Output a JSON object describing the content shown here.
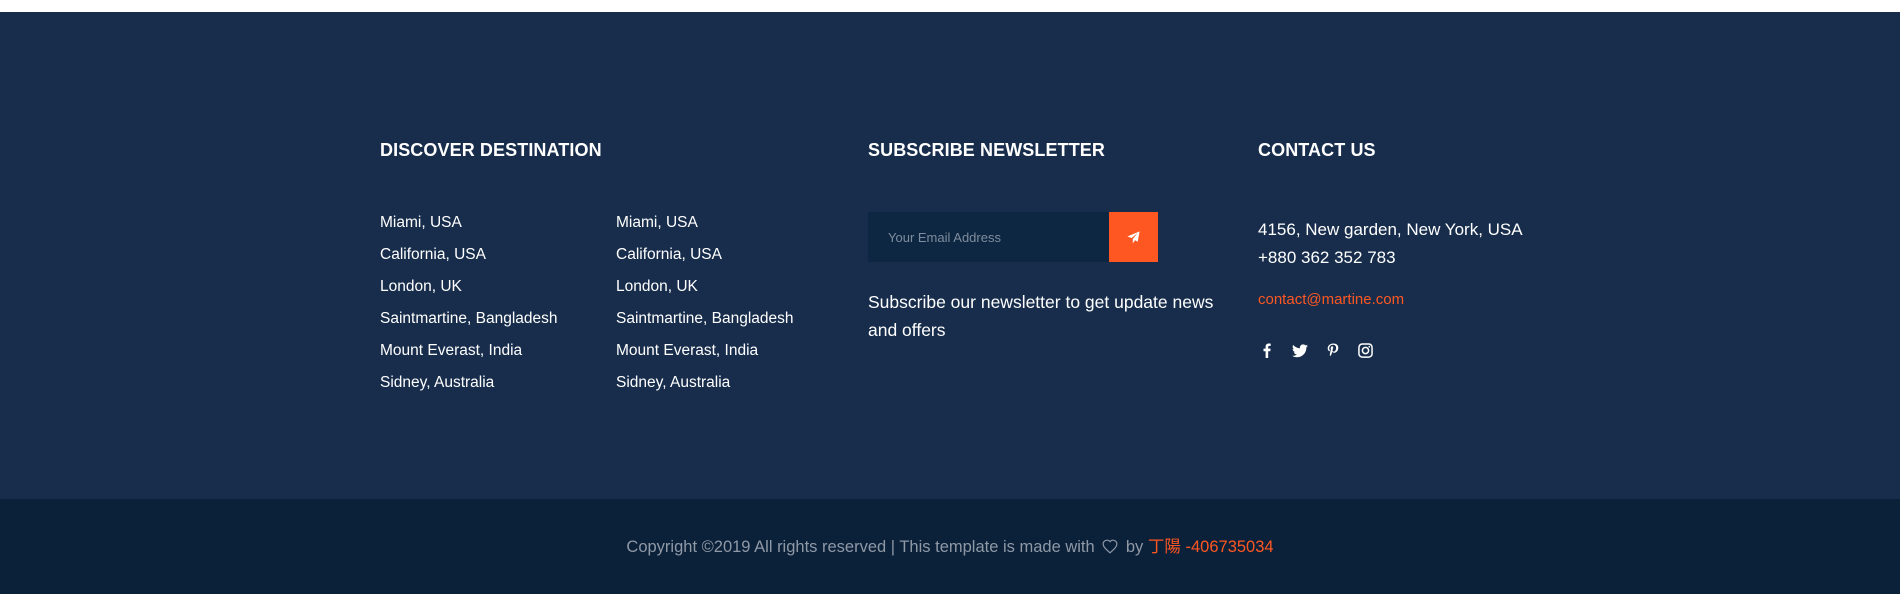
{
  "destination": {
    "heading": "DISCOVER DESTINATION",
    "column_a": [
      "Miami, USA",
      "California, USA",
      "London, UK",
      "Saintmartine, Bangladesh",
      "Mount Everast, India",
      "Sidney, Australia"
    ],
    "column_b": [
      "Miami, USA",
      "California, USA",
      "London, UK",
      "Saintmartine, Bangladesh",
      "Mount Everast, India",
      "Sidney, Australia"
    ]
  },
  "newsletter": {
    "heading": "SUBSCRIBE NEWSLETTER",
    "email_placeholder": "Your Email Address",
    "submit_icon": "paper-plane-icon",
    "description": "Subscribe our newsletter to get update news and offers"
  },
  "contact": {
    "heading": "CONTACT US",
    "address": "4156, New garden, New York, USA",
    "phone": "+880 362 352 783",
    "email": "contact@martine.com",
    "social_icons": [
      "facebook-icon",
      "twitter-icon",
      "pinterest-icon",
      "instagram-icon"
    ]
  },
  "copyright": {
    "prefix": "Copyright ©2019 All rights reserved | This template is made with",
    "heart_icon": "heart-icon",
    "by": "by",
    "author": "丁陽 -406735034"
  },
  "colors": {
    "footer_bg": "#172d4b",
    "bottom_bg": "#0b2039",
    "accent": "#ff5722"
  }
}
